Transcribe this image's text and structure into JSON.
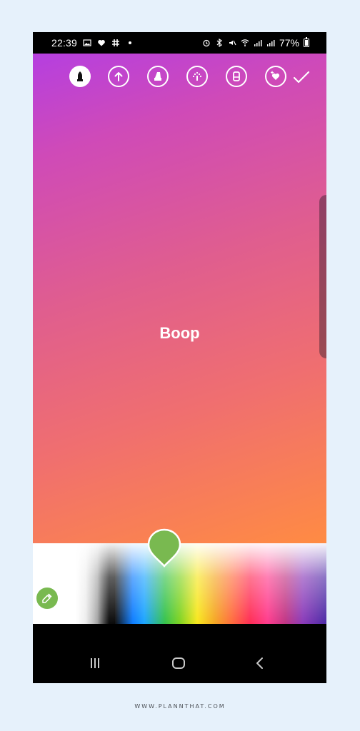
{
  "status_bar": {
    "time": "22:39",
    "battery": "77%",
    "battery_level": 0.77,
    "left_icons": [
      "image-icon",
      "heart-icon",
      "slack-icon",
      "dot-icon"
    ],
    "right_icons": [
      "alarm-icon",
      "bluetooth-icon",
      "mute-icon",
      "wifi-icon",
      "signal-icon",
      "signal-icon",
      "battery-icon"
    ]
  },
  "toolbar": {
    "tools": [
      {
        "name": "marker-tool",
        "icon": "marker-icon",
        "active": true
      },
      {
        "name": "arrow-tool",
        "icon": "arrow-up-icon",
        "active": false
      },
      {
        "name": "highlighter-tool",
        "icon": "highlighter-icon",
        "active": false
      },
      {
        "name": "chalk-tool",
        "icon": "chalk-icon",
        "active": false
      },
      {
        "name": "eraser-tool",
        "icon": "eraser-icon",
        "active": false
      },
      {
        "name": "heart-sparkle-tool",
        "icon": "heart-sparkle-icon",
        "active": false
      }
    ],
    "done_icon": "check-icon"
  },
  "canvas": {
    "text": "Boop",
    "gradient_colors": [
      "#b53fe0",
      "#cf4ab8",
      "#e05e8e",
      "#f06f6f",
      "#ff8b43"
    ]
  },
  "palette": {
    "selected_color": "#79b950",
    "eyedropper_icon": "eyedropper-icon",
    "colors": [
      "#ffffff",
      "#111111",
      "#0d7cff",
      "#35c24b",
      "#f8e71c",
      "#f5a623",
      "#ff2d55",
      "#c13584",
      "#4b2aa5"
    ]
  },
  "nav": {
    "recent_icon": "recent-apps-icon",
    "home_icon": "home-icon",
    "back_icon": "back-icon"
  },
  "footer": {
    "text": "WWW.PLANNTHAT.COM"
  }
}
